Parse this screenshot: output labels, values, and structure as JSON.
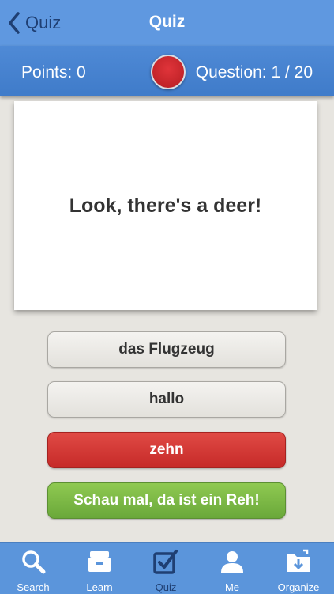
{
  "nav": {
    "back_label": "Quiz",
    "title": "Quiz"
  },
  "status": {
    "points": "Points: 0",
    "question": "Question: 1 / 20"
  },
  "card": {
    "text": "Look, there's a deer!"
  },
  "answers": [
    {
      "label": "das Flugzeug",
      "state": "neutral"
    },
    {
      "label": "hallo",
      "state": "neutral"
    },
    {
      "label": "zehn",
      "state": "wrong"
    },
    {
      "label": "Schau mal, da ist ein Reh!",
      "state": "correct"
    }
  ],
  "tabs": [
    {
      "label": "Search",
      "icon": "search-icon"
    },
    {
      "label": "Learn",
      "icon": "box-icon"
    },
    {
      "label": "Quiz",
      "icon": "checkbox-icon",
      "active": true
    },
    {
      "label": "Me",
      "icon": "person-icon"
    },
    {
      "label": "Organize",
      "icon": "folder-download-icon"
    }
  ],
  "colors": {
    "nav": "#5f98e0",
    "status": "#4583cf",
    "wrong": "#cf3431",
    "correct": "#78b543",
    "tab_active": "#1f3f73"
  }
}
